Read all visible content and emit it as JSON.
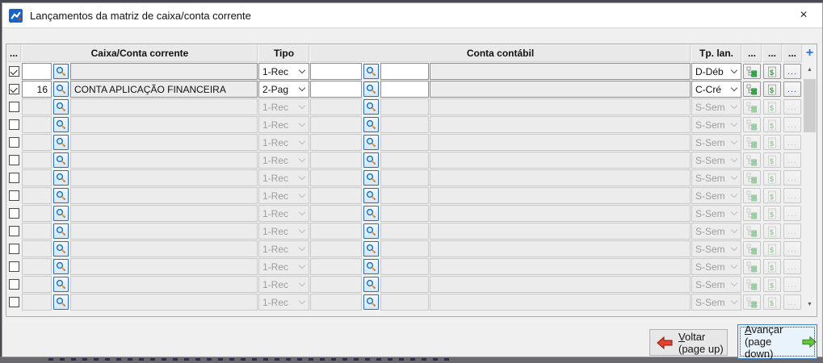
{
  "window": {
    "title": "Lançamentos da matriz de caixa/conta corrente",
    "close_glyph": "×"
  },
  "table": {
    "headers": {
      "dots0": "...",
      "caixa": "Caixa/Conta corrente",
      "tipo": "Tipo",
      "conta": "Conta contábil",
      "tplan": "Tp. lan.",
      "dots1": "...",
      "dots2": "...",
      "dots3": "...",
      "add": "+"
    },
    "icons": {
      "dots_button": "..."
    },
    "rows": [
      {
        "checked": true,
        "enabled": true,
        "code": "",
        "name": "",
        "tipo": "1-Rec",
        "code2": "",
        "code3": "",
        "conta": "",
        "tplan": "D-Déb"
      },
      {
        "checked": true,
        "enabled": true,
        "code": "16",
        "name": "CONTA APLICAÇÃO FINANCEIRA",
        "tipo": "2-Pag",
        "code2": "",
        "code3": "",
        "conta": "",
        "tplan": "C-Cré"
      },
      {
        "checked": false,
        "enabled": false,
        "code": "",
        "name": "",
        "tipo": "1-Rec",
        "code2": "",
        "code3": "",
        "conta": "",
        "tplan": "S-Sem"
      },
      {
        "checked": false,
        "enabled": false,
        "code": "",
        "name": "",
        "tipo": "1-Rec",
        "code2": "",
        "code3": "",
        "conta": "",
        "tplan": "S-Sem"
      },
      {
        "checked": false,
        "enabled": false,
        "code": "",
        "name": "",
        "tipo": "1-Rec",
        "code2": "",
        "code3": "",
        "conta": "",
        "tplan": "S-Sem"
      },
      {
        "checked": false,
        "enabled": false,
        "code": "",
        "name": "",
        "tipo": "1-Rec",
        "code2": "",
        "code3": "",
        "conta": "",
        "tplan": "S-Sem"
      },
      {
        "checked": false,
        "enabled": false,
        "code": "",
        "name": "",
        "tipo": "1-Rec",
        "code2": "",
        "code3": "",
        "conta": "",
        "tplan": "S-Sem"
      },
      {
        "checked": false,
        "enabled": false,
        "code": "",
        "name": "",
        "tipo": "1-Rec",
        "code2": "",
        "code3": "",
        "conta": "",
        "tplan": "S-Sem"
      },
      {
        "checked": false,
        "enabled": false,
        "code": "",
        "name": "",
        "tipo": "1-Rec",
        "code2": "",
        "code3": "",
        "conta": "",
        "tplan": "S-Sem"
      },
      {
        "checked": false,
        "enabled": false,
        "code": "",
        "name": "",
        "tipo": "1-Rec",
        "code2": "",
        "code3": "",
        "conta": "",
        "tplan": "S-Sem"
      },
      {
        "checked": false,
        "enabled": false,
        "code": "",
        "name": "",
        "tipo": "1-Rec",
        "code2": "",
        "code3": "",
        "conta": "",
        "tplan": "S-Sem"
      },
      {
        "checked": false,
        "enabled": false,
        "code": "",
        "name": "",
        "tipo": "1-Rec",
        "code2": "",
        "code3": "",
        "conta": "",
        "tplan": "S-Sem"
      },
      {
        "checked": false,
        "enabled": false,
        "code": "",
        "name": "",
        "tipo": "1-Rec",
        "code2": "",
        "code3": "",
        "conta": "",
        "tplan": "S-Sem"
      },
      {
        "checked": false,
        "enabled": false,
        "code": "",
        "name": "",
        "tipo": "1-Rec",
        "code2": "",
        "code3": "",
        "conta": "",
        "tplan": "S-Sem"
      }
    ]
  },
  "scrollbar": {
    "up": "▲",
    "down": "▼"
  },
  "footer": {
    "voltar": {
      "initial": "V",
      "rest": "oltar",
      "sub": "(page up)"
    },
    "avancar": {
      "initial": "A",
      "rest": "vançar",
      "sub": "(page down)"
    }
  },
  "colors": {
    "accent_blue": "#2f6fd6",
    "lookup_border": "#2e6db5",
    "tree_green": "#3db04c",
    "money_green": "#2e9e3c",
    "arrow_red": "#e3422c",
    "arrow_green": "#66c83d",
    "focus_button_bg": "#e9f3fc",
    "focus_button_border": "#3f82bf"
  }
}
